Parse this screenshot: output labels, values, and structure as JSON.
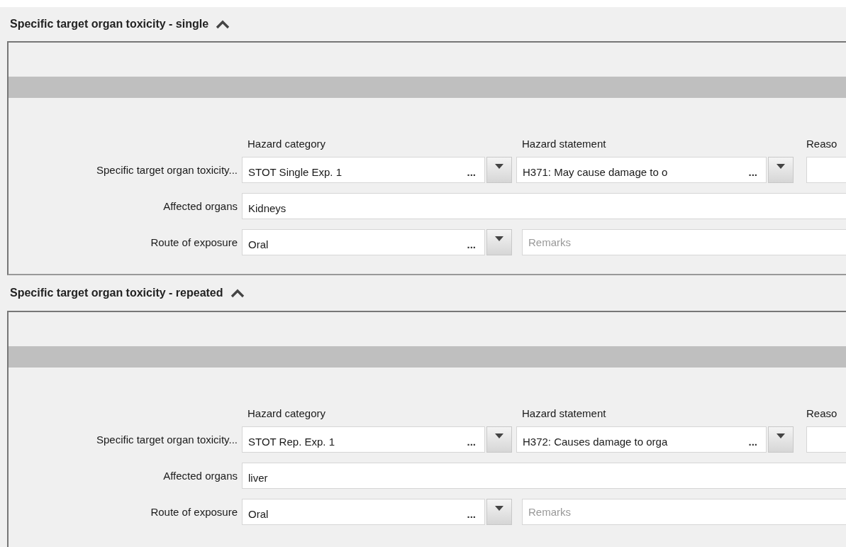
{
  "sections": [
    {
      "title": "Specific target organ toxicity - single",
      "expanded": true,
      "columns": [
        "Hazard category",
        "Hazard statement",
        "Reaso"
      ],
      "row_label": "Specific target organ toxicity...",
      "hazard_category": {
        "value": "STOT Single Exp. 1",
        "more": "..."
      },
      "hazard_statement": {
        "value": "H371: May cause damage to o",
        "more": "..."
      },
      "affected_organs": {
        "label": "Affected organs",
        "value": "Kidneys"
      },
      "route_of_exposure": {
        "label": "Route of exposure",
        "value": "Oral",
        "more": "..."
      },
      "remarks": {
        "placeholder": "Remarks"
      }
    },
    {
      "title": "Specific target organ toxicity - repeated",
      "expanded": true,
      "columns": [
        "Hazard category",
        "Hazard statement",
        "Reaso"
      ],
      "row_label": "Specific target organ toxicity...",
      "hazard_category": {
        "value": "STOT Rep. Exp. 1",
        "more": "..."
      },
      "hazard_statement": {
        "value": "H372: Causes damage to orga",
        "more": "..."
      },
      "affected_organs": {
        "label": "Affected organs",
        "value": "liver"
      },
      "route_of_exposure": {
        "label": "Route of exposure",
        "value": "Oral",
        "more": "..."
      },
      "remarks": {
        "placeholder": "Remarks"
      }
    }
  ]
}
